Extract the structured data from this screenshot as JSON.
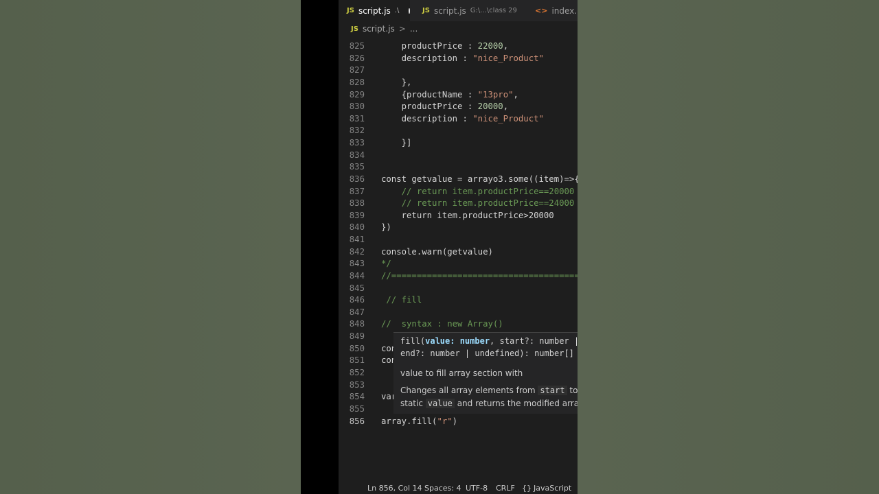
{
  "tabs": [
    {
      "icon": "JS",
      "label": "script.js",
      "hint": ".\\",
      "modified": true
    },
    {
      "icon": "JS",
      "label": "script.js",
      "hint": "G:\\...\\class 29"
    },
    {
      "icon": "<>",
      "label": "index.htm"
    }
  ],
  "breadcrumb": {
    "icon": "JS",
    "file": "script.js",
    "sep": ">",
    "more": "..."
  },
  "code_lines": [
    {
      "n": "825",
      "tokens": [
        {
          "c": "plain",
          "t": "    productPrice : "
        },
        {
          "c": "number",
          "t": "22000"
        },
        {
          "c": "plain",
          "t": ","
        }
      ]
    },
    {
      "n": "826",
      "tokens": [
        {
          "c": "plain",
          "t": "    description : "
        },
        {
          "c": "string",
          "t": "\"nice_Product\""
        }
      ]
    },
    {
      "n": "827",
      "tokens": []
    },
    {
      "n": "828",
      "tokens": [
        {
          "c": "plain",
          "t": "    },"
        }
      ]
    },
    {
      "n": "829",
      "tokens": [
        {
          "c": "plain",
          "t": "    {productName : "
        },
        {
          "c": "string",
          "t": "\"13pro\""
        },
        {
          "c": "plain",
          "t": ","
        }
      ]
    },
    {
      "n": "830",
      "tokens": [
        {
          "c": "plain",
          "t": "    productPrice : "
        },
        {
          "c": "number",
          "t": "20000"
        },
        {
          "c": "plain",
          "t": ","
        }
      ]
    },
    {
      "n": "831",
      "tokens": [
        {
          "c": "plain",
          "t": "    description : "
        },
        {
          "c": "string",
          "t": "\"nice_Product\""
        }
      ]
    },
    {
      "n": "832",
      "tokens": []
    },
    {
      "n": "833",
      "tokens": [
        {
          "c": "plain",
          "t": "    }]"
        }
      ]
    },
    {
      "n": "834",
      "tokens": []
    },
    {
      "n": "835",
      "tokens": []
    },
    {
      "n": "836",
      "tokens": [
        {
          "c": "plain",
          "t": "const getvalue = arrayo3.some((item)=>{"
        }
      ]
    },
    {
      "n": "837",
      "tokens": [
        {
          "c": "plain",
          "t": "    // return item.productPrice==20000"
        }
      ]
    },
    {
      "n": "838",
      "tokens": [
        {
          "c": "plain",
          "t": "    // return item.productPrice==24000"
        }
      ]
    },
    {
      "n": "839",
      "tokens": [
        {
          "c": "plain",
          "t": "    return item.productPrice>20000"
        }
      ]
    },
    {
      "n": "840",
      "tokens": [
        {
          "c": "plain",
          "t": "})"
        }
      ]
    },
    {
      "n": "841",
      "tokens": []
    },
    {
      "n": "842",
      "tokens": [
        {
          "c": "plain",
          "t": "console.warn(getvalue)"
        }
      ]
    },
    {
      "n": "843",
      "tokens": [
        {
          "c": "plain",
          "t": "*/"
        }
      ]
    },
    {
      "n": "844",
      "tokens": [
        {
          "c": "plain",
          "t": "//=========================================="
        }
      ]
    },
    {
      "n": "845",
      "tokens": []
    },
    {
      "n": "846",
      "tokens": [
        {
          "c": "plain",
          "t": " // fill"
        }
      ]
    },
    {
      "n": "847",
      "tokens": []
    },
    {
      "n": "848",
      "tokens": [
        {
          "c": "plain",
          "t": "//  syntax : new Array()"
        }
      ]
    },
    {
      "n": "849",
      "tokens": []
    },
    {
      "n": "850",
      "tokens": [
        {
          "c": "plain",
          "t": "con"
        }
      ]
    },
    {
      "n": "851",
      "tokens": [
        {
          "c": "plain",
          "t": "con"
        }
      ]
    },
    {
      "n": "852",
      "tokens": []
    },
    {
      "n": "853",
      "tokens": []
    },
    {
      "n": "854",
      "tokens": [
        {
          "c": "plain",
          "t": "var"
        }
      ]
    },
    {
      "n": "855",
      "tokens": []
    },
    {
      "n": "856",
      "current": true,
      "tokens": [
        {
          "c": "plain",
          "t": "array.fill("
        },
        {
          "c": "string",
          "t": "\"r\""
        },
        {
          "c": "plain",
          "t": ")"
        }
      ]
    }
  ],
  "hover": {
    "sig_name": "fill(",
    "sig_param": "value: number",
    "sig_rest1": ", start?: number |",
    "sig_line2": "end?: number | undefined): number[]",
    "param_doc": "value to fill array section with",
    "desc_1a": "Changes all array elements from ",
    "desc_code1": "start",
    "desc_1b": " to ",
    "desc_2a": "static ",
    "desc_code2": "value",
    "desc_2b": " and returns the modified array"
  },
  "status": {
    "position": "Ln 856, Col 14",
    "spaces": "Spaces: 4",
    "encoding": "UTF-8",
    "eol": "CRLF",
    "language_icon": "{}",
    "language": "JavaScript"
  }
}
